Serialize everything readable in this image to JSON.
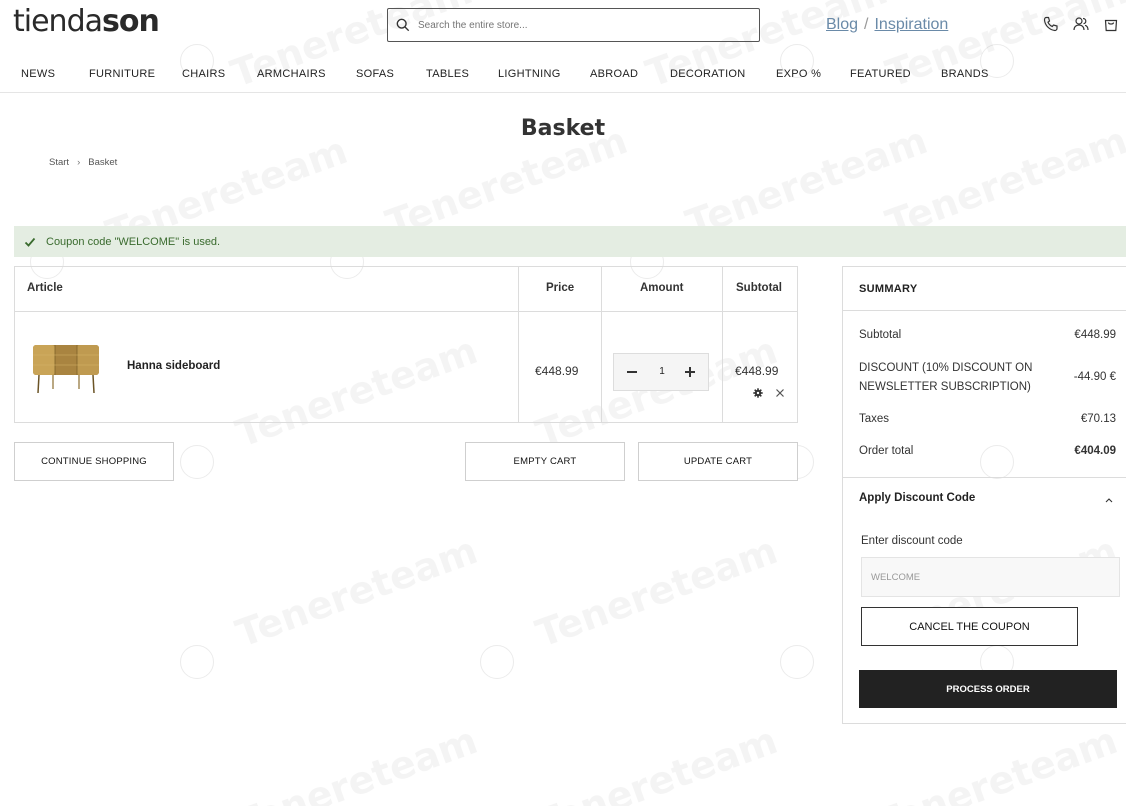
{
  "header": {
    "logo_light": "tienda",
    "logo_bold": "son",
    "search_placeholder": "Search the entire store...",
    "links": [
      {
        "label": "Blog"
      },
      {
        "label": "Inspiration"
      }
    ],
    "link_separator": "/"
  },
  "nav": {
    "items": [
      {
        "label": "NEWS"
      },
      {
        "label": "FURNITURE"
      },
      {
        "label": "CHAIRS"
      },
      {
        "label": "ARMCHAIRS"
      },
      {
        "label": "SOFAS"
      },
      {
        "label": "TABLES"
      },
      {
        "label": "LIGHTNING"
      },
      {
        "label": "ABROAD"
      },
      {
        "label": "DECORATION"
      },
      {
        "label": "EXPO %"
      },
      {
        "label": "FEATURED"
      },
      {
        "label": "BRANDS"
      }
    ]
  },
  "page": {
    "title": "Basket",
    "breadcrumb": [
      {
        "label": "Start"
      },
      {
        "label": "Basket"
      }
    ]
  },
  "notice": {
    "text": "Coupon code \"WELCOME\" is used."
  },
  "cart": {
    "headers": {
      "article": "Article",
      "price": "Price",
      "amount": "Amount",
      "subtotal": "Subtotal"
    },
    "items": [
      {
        "name": "Hanna sideboard",
        "price": "€448.99",
        "quantity": "1",
        "subtotal": "€448.99"
      }
    ],
    "buttons": {
      "continue": "CONTINUE SHOPPING",
      "empty": "EMPTY CART",
      "update": "UPDATE CART"
    }
  },
  "summary": {
    "title": "SUMMARY",
    "subtotal_label": "Subtotal",
    "subtotal_value": "€448.99",
    "discount_label": "DISCOUNT (10% DISCOUNT ON NEWSLETTER SUBSCRIPTION)",
    "discount_value": "-44.90 €",
    "taxes_label": "Taxes",
    "taxes_value": "€70.13",
    "total_label": "Order total",
    "total_value": "€404.09"
  },
  "discount": {
    "header": "Apply Discount Code",
    "label": "Enter discount code",
    "input_value": "WELCOME",
    "cancel_button": "CANCEL THE COUPON"
  },
  "checkout": {
    "process_button": "PROCESS ORDER"
  },
  "watermark": {
    "text": "Tenereteam"
  },
  "colors": {
    "notice_bg": "#e4ede2",
    "notice_text": "#3a6b2e",
    "link": "#6a8aa8",
    "primary_button": "#222222"
  }
}
